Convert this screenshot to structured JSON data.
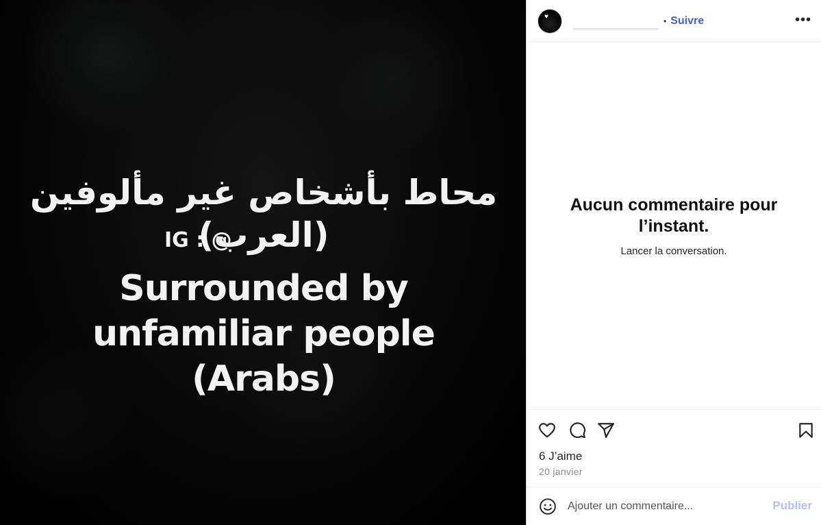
{
  "media": {
    "caption_arabic": "محاط بأشخاص غير مألوفين (العرب)",
    "caption_ig": "IG : @",
    "caption_english_line1": "Surrounded by unfamiliar people",
    "caption_english_line2": "(Arabs)"
  },
  "header": {
    "separator": "•",
    "follow_label": "Suivre",
    "more_label": "•••"
  },
  "comments": {
    "empty_title": "Aucun commentaire pour l’instant.",
    "empty_subtitle": "Lancer la conversation."
  },
  "actions": {
    "icons": [
      "heart-icon",
      "comment-icon",
      "share-icon",
      "bookmark-icon"
    ]
  },
  "post": {
    "likes": "6 J’aime",
    "date": "20 janvier"
  },
  "comment_bar": {
    "placeholder": "Ajouter un commentaire...",
    "publish_label": "Publier"
  },
  "colors": {
    "follow": "#4a5dc7",
    "publish_disabled": "#b3c2f2"
  }
}
